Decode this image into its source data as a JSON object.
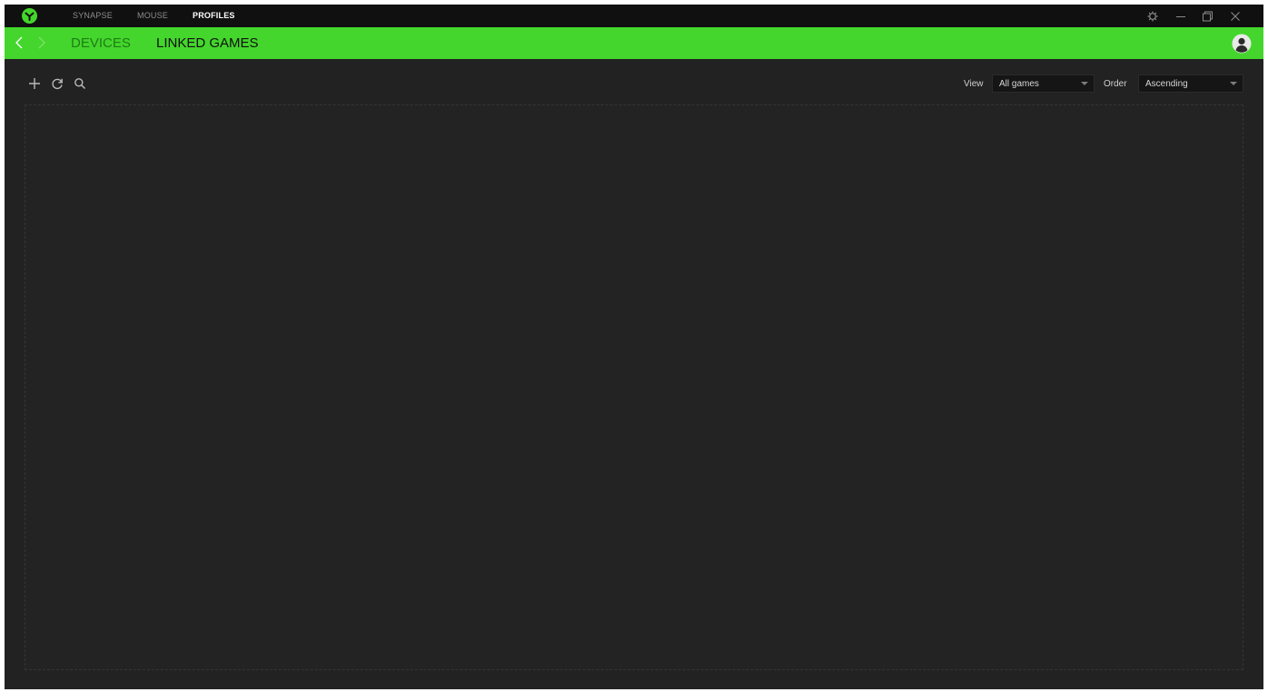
{
  "titlebar": {
    "tabs": [
      {
        "label": "SYNAPSE",
        "active": false
      },
      {
        "label": "MOUSE",
        "active": false
      },
      {
        "label": "PROFILES",
        "active": true
      }
    ],
    "icons": [
      "razer-logo-icon",
      "settings-icon",
      "minimize-icon",
      "maximize-icon",
      "close-icon"
    ]
  },
  "subheader": {
    "tabs": [
      {
        "label": "DEVICES",
        "active": false
      },
      {
        "label": "LINKED GAMES",
        "active": true
      }
    ],
    "icons": [
      "back-arrow-icon",
      "forward-arrow-icon",
      "account-icon"
    ]
  },
  "toolbar": {
    "icons": [
      "add-icon",
      "refresh-icon",
      "search-icon"
    ],
    "view": {
      "label": "View",
      "value": "All games"
    },
    "order": {
      "label": "Order",
      "value": "Ascending"
    }
  },
  "colors": {
    "accent": "#44d62c",
    "titlebar_bg": "#101010",
    "content_bg": "#222222"
  }
}
